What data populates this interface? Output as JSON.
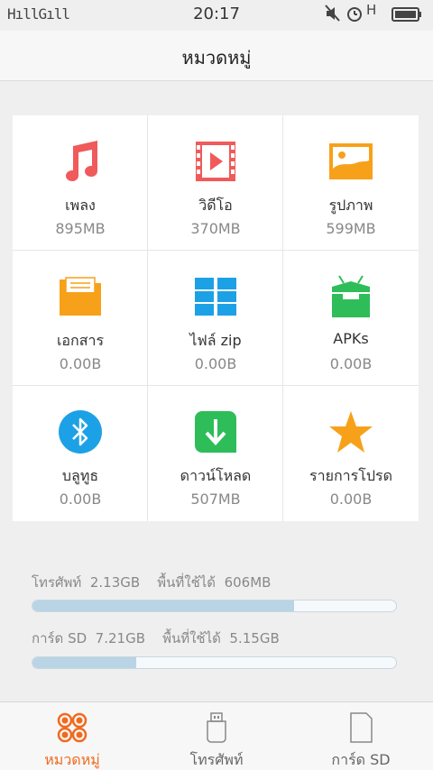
{
  "status_bar": {
    "signal": "HıllGıll",
    "time": "20:17",
    "network": "H"
  },
  "header": {
    "title": "หมวดหมู่"
  },
  "categories": [
    {
      "name": "เพลง",
      "size": "895MB",
      "icon": "music-icon"
    },
    {
      "name": "วิดีโอ",
      "size": "370MB",
      "icon": "video-icon"
    },
    {
      "name": "รูปภาพ",
      "size": "599MB",
      "icon": "image-icon"
    },
    {
      "name": "เอกสาร",
      "size": "0.00B",
      "icon": "folder-icon"
    },
    {
      "name": "ไฟล์ zip",
      "size": "0.00B",
      "icon": "zip-icon"
    },
    {
      "name": "APKs",
      "size": "0.00B",
      "icon": "android-icon"
    },
    {
      "name": "บลูทูธ",
      "size": "0.00B",
      "icon": "bluetooth-icon"
    },
    {
      "name": "ดาวน์โหลด",
      "size": "507MB",
      "icon": "download-icon"
    },
    {
      "name": "รายการโปรด",
      "size": "0.00B",
      "icon": "star-icon"
    }
  ],
  "storage": {
    "phone": {
      "label": "โทรศัพท์  2.13GB    พื้นที่ใช้ได้  606MB",
      "used_fraction": 0.72
    },
    "sd": {
      "label": "การ์ด SD  7.21GB    พื้นที่ใช้ได้  5.15GB",
      "used_fraction": 0.285
    }
  },
  "tabs": [
    {
      "label": "หมวดหมู่",
      "icon": "categories-icon",
      "active": true
    },
    {
      "label": "โทรศัพท์",
      "icon": "usb-storage-icon",
      "active": false
    },
    {
      "label": "การ์ด SD",
      "icon": "sd-card-icon",
      "active": false
    }
  ],
  "colors": {
    "accent": "#f06a1d",
    "music": "#f05a5a",
    "video": "#f05a5a",
    "image": "#f7a11a",
    "folder": "#f7a11a",
    "zip": "#1da1e6",
    "android": "#2ebd59",
    "bluetooth": "#1da1e6",
    "download": "#2ebd59",
    "star": "#f7a11a",
    "bar_fill": "#b9d4e4"
  }
}
